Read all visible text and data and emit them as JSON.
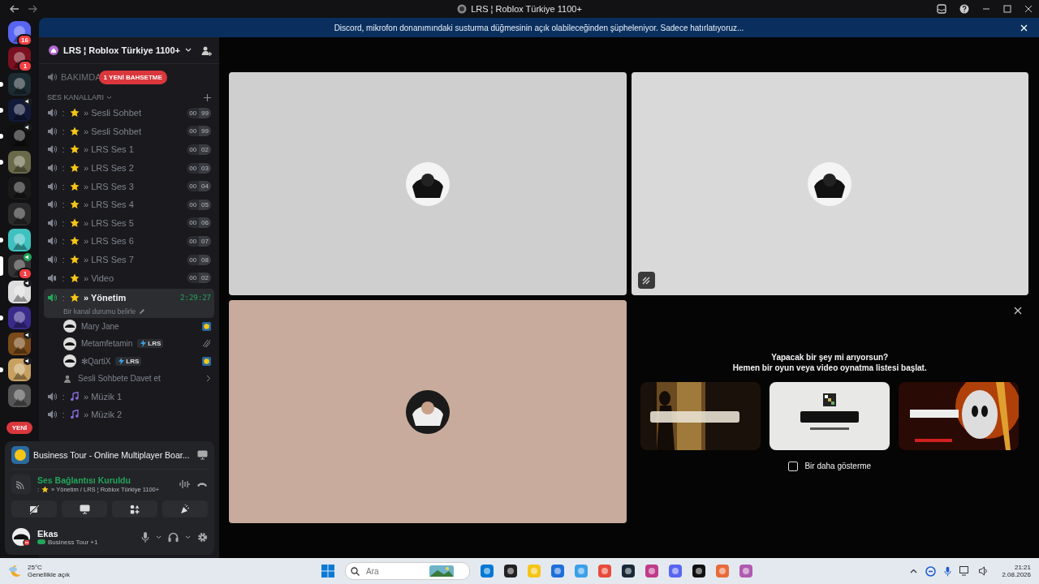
{
  "window": {
    "title": "LRS ¦ Roblox Türkiye 1100+"
  },
  "notice": {
    "text": "Discord, mikrofon donanımındaki susturma düğmesinin açık olabileceğinden şüpheleniyor. Sadece hatırlatıyoruz..."
  },
  "servers": [
    {
      "unread": false,
      "voice": false,
      "selected": false,
      "badge": "16"
    },
    {
      "unread": false,
      "voice": false,
      "selected": false,
      "badge": "1"
    },
    {
      "unread": true,
      "voice": false,
      "selected": false
    },
    {
      "unread": true,
      "voice": true,
      "selected": false
    },
    {
      "unread": true,
      "voice": true,
      "selected": false
    },
    {
      "unread": true,
      "voice": false,
      "selected": false
    },
    {
      "unread": false,
      "voice": false,
      "selected": false
    },
    {
      "unread": false,
      "voice": false,
      "selected": false
    },
    {
      "unread": true,
      "voice": false,
      "selected": false
    },
    {
      "unread": false,
      "voice": true,
      "selected": true,
      "badge": "1"
    },
    {
      "unread": false,
      "voice": true,
      "selected": false
    },
    {
      "unread": true,
      "voice": false,
      "selected": false
    },
    {
      "unread": false,
      "voice": true,
      "selected": false
    },
    {
      "unread": true,
      "voice": true,
      "selected": false
    },
    {
      "unread": false,
      "voice": false,
      "selected": false
    }
  ],
  "new_label": "YENİ",
  "server": {
    "name": "LRS ¦ Roblox Türkiye 1100+",
    "top_channel": "BAKIMDA",
    "mention": "1 YENİ BAHSETME",
    "category": "SES KANALLARI"
  },
  "channels": [
    {
      "kind": "voice",
      "separator": ":",
      "name": "» Sesli Sohbet",
      "count": "00",
      "limit": "99",
      "selected": false
    },
    {
      "kind": "voice",
      "separator": ":",
      "name": "» Sesli Sohbet",
      "count": "00",
      "limit": "99",
      "selected": false
    },
    {
      "kind": "voice",
      "separator": ":",
      "name": "» LRS Ses 1",
      "count": "00",
      "limit": "02",
      "selected": false
    },
    {
      "kind": "voice",
      "separator": ":",
      "name": "» LRS Ses 2",
      "count": "00",
      "limit": "03",
      "selected": false
    },
    {
      "kind": "voice",
      "separator": ":",
      "name": "» LRS Ses 3",
      "count": "00",
      "limit": "04",
      "selected": false
    },
    {
      "kind": "voice",
      "separator": ":",
      "name": "» LRS Ses 4",
      "count": "00",
      "limit": "05",
      "selected": false
    },
    {
      "kind": "voice",
      "separator": ":",
      "name": "» LRS Ses 5",
      "count": "00",
      "limit": "06",
      "selected": false
    },
    {
      "kind": "voice",
      "separator": ":",
      "name": "» LRS Ses 6",
      "count": "00",
      "limit": "07",
      "selected": false
    },
    {
      "kind": "voice",
      "separator": ":",
      "name": "» LRS Ses 7",
      "count": "00",
      "limit": "08",
      "selected": false
    },
    {
      "kind": "video",
      "separator": ":",
      "name": "» Video",
      "count": "00",
      "limit": "02",
      "selected": false
    },
    {
      "kind": "active",
      "separator": ":",
      "name": "» Yönetim",
      "timer": "2:29:27",
      "status": "Bir kanal durumu belirle",
      "selected": true,
      "members": [
        {
          "name": "Mary Jane",
          "kind": "coin"
        },
        {
          "name": "Metamfetamin",
          "tag": "LRS",
          "kind": "muted"
        },
        {
          "name": "✻QartiX",
          "tag": "LRS",
          "kind": "coin"
        }
      ],
      "invite": "Sesli Sohbete Davet et"
    },
    {
      "kind": "music",
      "separator": ":",
      "name": "» Müzik 1",
      "selected": false
    },
    {
      "kind": "music",
      "separator": ":",
      "name": "» Müzik 2",
      "selected": false
    }
  ],
  "activity": {
    "title": "Business Tour - Online Multiplayer Boar..."
  },
  "voice": {
    "status": "Ses Bağlantısı Kuruldu",
    "separator": ":",
    "location": "» Yönetim / LRS ¦ Roblox Türkiye 1100+"
  },
  "user": {
    "name": "Ekas",
    "activity": "Business Tour +1"
  },
  "tiles": [
    {
      "color": "#cfcfcf",
      "muted": false
    },
    {
      "color": "#d9d9d9",
      "muted": true
    },
    {
      "color": "#c8ab9c",
      "muted": false
    }
  ],
  "promo": {
    "heading": "Yapacak bir şey mi arıyorsun?",
    "subheading": "Hemen bir oyun veya video oynatma listesi başlat.",
    "checkbox": {
      "label": "Bir daha gösterme",
      "checked": false
    }
  },
  "taskbar": {
    "temperature": "25°C",
    "weather": "Genellikle açık",
    "search": {
      "placeholder": "Ara"
    },
    "time": "21:21",
    "date": "2.08.2026"
  }
}
